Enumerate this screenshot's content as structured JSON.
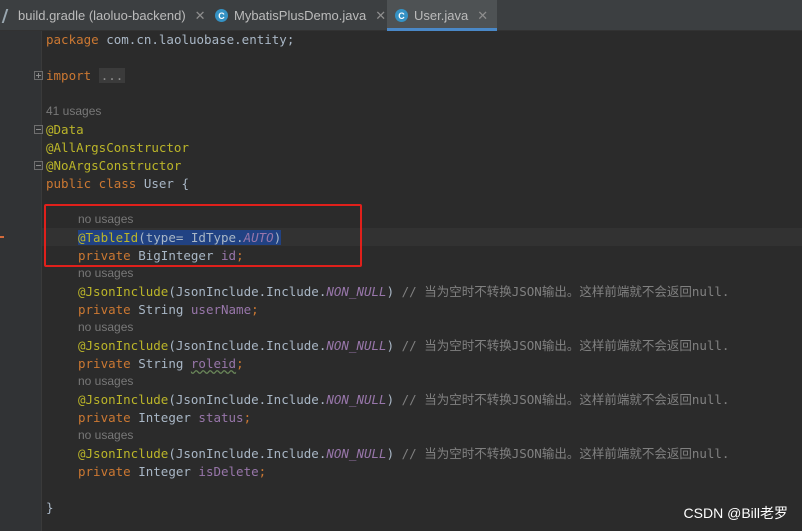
{
  "tabs": [
    {
      "label": "build.gradle (laoluo-backend)",
      "icon": "gradle-icon",
      "active": false
    },
    {
      "label": "MybatisPlusDemo.java",
      "icon": "class-icon",
      "active": false
    },
    {
      "label": "User.java",
      "icon": "class-icon",
      "active": true
    }
  ],
  "code": {
    "package_kw": "package",
    "package_name": " com.cn.laoluobase.entity;",
    "import_kw": "import",
    "import_folded": "...",
    "class_usages": "41 usages",
    "ann_data": "@Data",
    "ann_allargs": "@AllArgsConstructor",
    "ann_noargs": "@NoArgsConstructor",
    "class_decl_kw": "public class",
    "class_name": " User {",
    "no_usages": "no usages",
    "id_ann": "@TableId",
    "id_ann_args": "(type= IdType.",
    "id_ann_const": "AUTO",
    "id_ann_close": ")",
    "private_kw": "private",
    "json_include": "@JsonInclude",
    "json_include_args": "(JsonInclude.Include.",
    "non_null": "NON_NULL",
    "comment": "// 当为空时不转换JSON输出。这样前端就不会返回null.",
    "fields": [
      {
        "type": " BigInteger ",
        "name": "id",
        "end": ";"
      },
      {
        "type": " String ",
        "name": "userName",
        "end": ";"
      },
      {
        "type": " String ",
        "name": "roleid",
        "end": ";"
      },
      {
        "type": " Integer ",
        "name": "status",
        "end": ";"
      },
      {
        "type": " Integer ",
        "name": "isDelete",
        "end": ";"
      }
    ],
    "closing_brace": "}"
  },
  "watermark": "CSDN @Bill老罗",
  "colors": {
    "keyword": "#cc7832",
    "annotation": "#bbb529",
    "field": "#9876aa",
    "comment": "#808080",
    "highlight_box": "#e0201b",
    "active_tab_underline": "#4a88c7"
  }
}
